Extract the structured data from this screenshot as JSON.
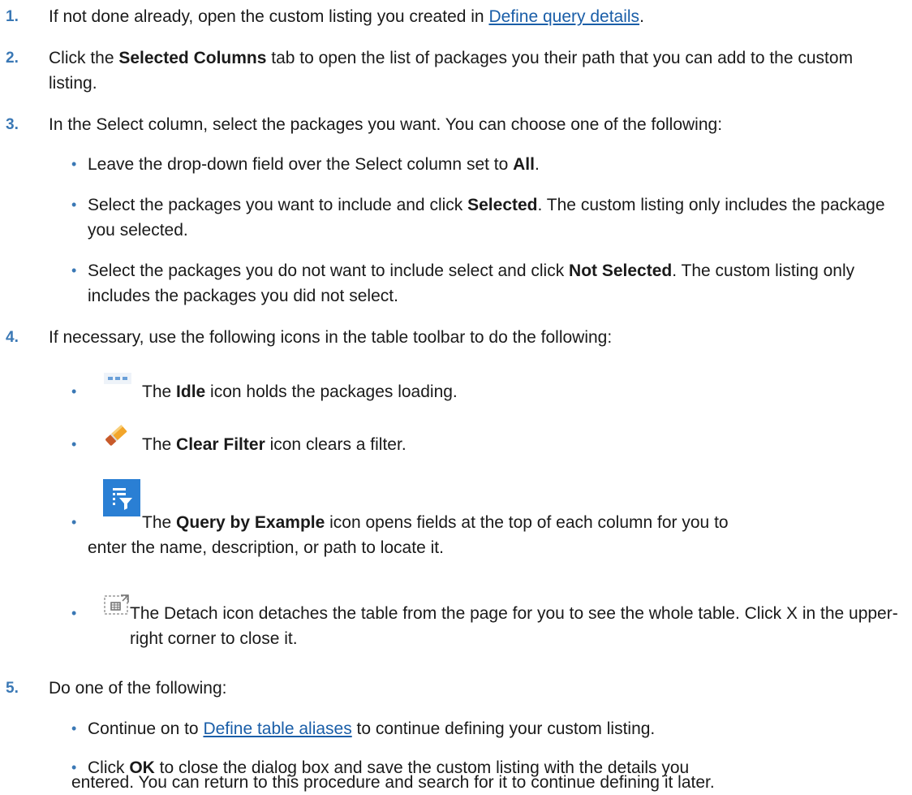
{
  "steps": [
    {
      "num": "1.",
      "pre": "If not done already, open the custom listing you created in ",
      "link": "Define query details",
      "post": "."
    },
    {
      "num": "2.",
      "pre": "Click the ",
      "bold": "Selected Columns",
      "post": " tab to open the list of packages you their path that you can add to the custom listing."
    },
    {
      "num": "3.",
      "text": "In the Select column, select the packages you want. You can choose one of the following:"
    },
    {
      "num": "4.",
      "text": "If necessary, use the following icons in the table toolbar to do the following:"
    },
    {
      "num": "5.",
      "text": "Do one of the following:"
    }
  ],
  "step3_bullets": [
    {
      "pre": "Leave the drop-down field over the Select column set to ",
      "bold": "All",
      "post": "."
    },
    {
      "pre": "Select the packages you want to include and click ",
      "bold": "Selected",
      "post": ". The custom listing only includes the package you selected."
    },
    {
      "pre": "Select the packages you do not want to include select and click ",
      "bold": "Not Selected",
      "post": ". The custom listing only includes the packages you did not select."
    }
  ],
  "step4_bullets": [
    {
      "icon": "idle-icon",
      "pre": "The ",
      "bold": "Idle",
      "post": " icon holds the packages loading."
    },
    {
      "icon": "eraser-icon",
      "pre": "The ",
      "bold": "Clear Filter",
      "post": " icon clears a filter."
    },
    {
      "icon": "query-by-example-icon",
      "pre": "The ",
      "bold": "Query by Example",
      "post": " icon opens fields at the top of each column for you to enter the name, description, or path to locate it."
    },
    {
      "icon": "detach-icon",
      "text": "The Detach icon detaches the table from the page for you to see the whole table. Click X in the upper-right corner to close it."
    }
  ],
  "step5_bullets": [
    {
      "pre": "Continue on to ",
      "link": "Define table aliases",
      "post": " to continue defining your custom listing."
    },
    {
      "pre": "Click ",
      "bold": "OK",
      "post": " to close the dialog box and save the custom listing with the details you entered. You can return to this procedure and search for it to continue defining it later."
    }
  ],
  "bullet_char": "•",
  "colors": {
    "number": "#3a78b5",
    "link": "#1a5ea8",
    "icon_blue": "#2a7fd4"
  }
}
